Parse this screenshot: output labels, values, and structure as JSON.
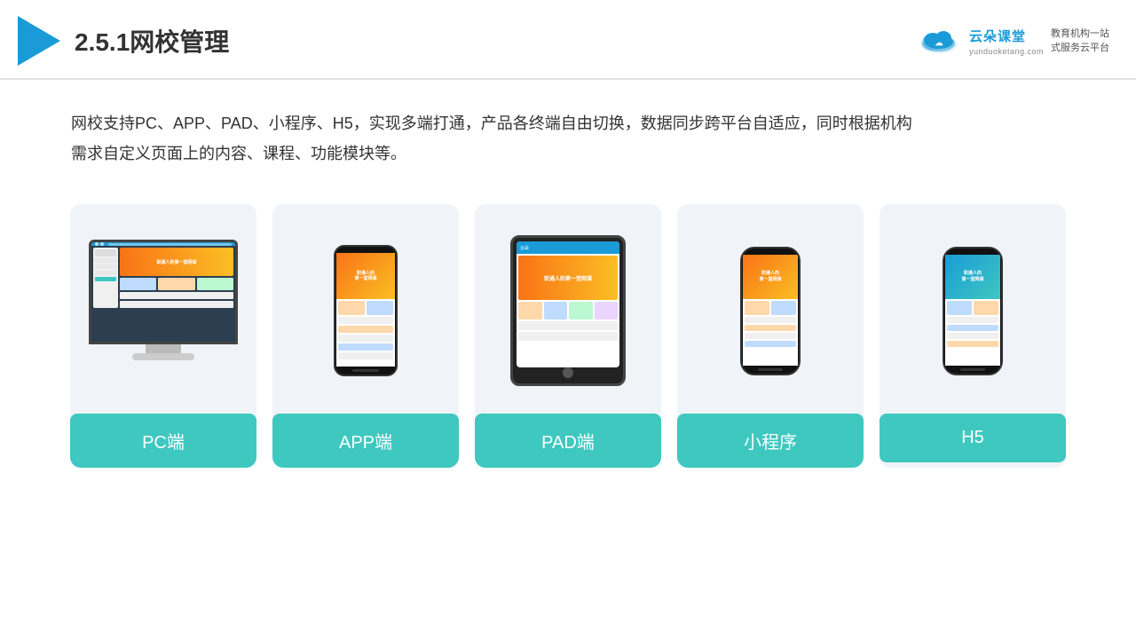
{
  "header": {
    "title": "2.5.1网校管理",
    "brand": {
      "name": "云朵课堂",
      "url": "yunduoketang.com",
      "slogan": "教育机构一站\n式服务云平台"
    }
  },
  "description": "网校支持PC、APP、PAD、小程序、H5，实现多端打通，产品各终端自由切换，数据同步跨平台自适应，同时根据机构\n需求自定义页面上的内容、课程、功能模块等。",
  "cards": [
    {
      "id": "pc",
      "label": "PC端",
      "type": "pc"
    },
    {
      "id": "app",
      "label": "APP端",
      "type": "phone"
    },
    {
      "id": "pad",
      "label": "PAD端",
      "type": "tablet"
    },
    {
      "id": "mini",
      "label": "小程序",
      "type": "phone2"
    },
    {
      "id": "h5",
      "label": "H5",
      "type": "phone3"
    }
  ],
  "colors": {
    "teal": "#3ec8c0",
    "blue": "#1a9bd7",
    "orange": "#f97316"
  }
}
